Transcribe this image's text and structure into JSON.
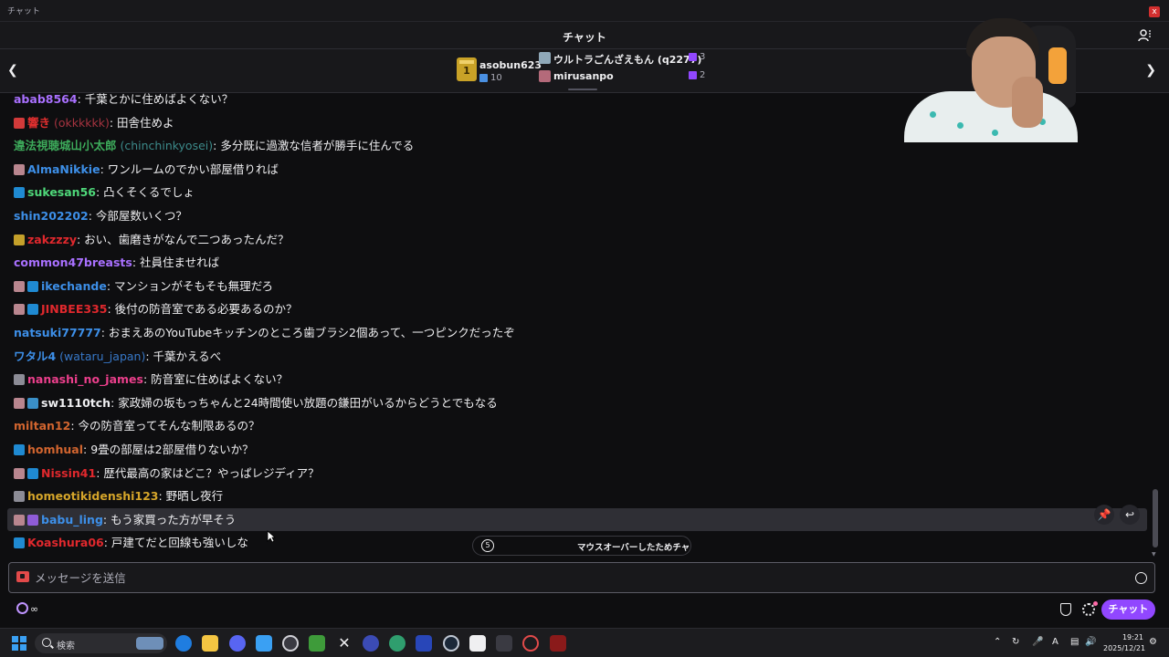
{
  "window": {
    "title": "チャット",
    "close_label": "x"
  },
  "header": {
    "title": "チャット"
  },
  "leaderboard": {
    "first": {
      "name": "asobun623",
      "rank": "1",
      "count": "10"
    },
    "others": [
      {
        "name": "ウルトラごんざえもん (q2277)",
        "count": "3"
      },
      {
        "name": "mirusanpo",
        "count": "2"
      }
    ]
  },
  "messages": [
    {
      "user": "abab8564",
      "user_color": "#a970ff",
      "alt": "",
      "text": ": 千葉とかに住めばよくない？",
      "badges": []
    },
    {
      "user": "響き",
      "user_color": "#e02f2f",
      "alt": " (okkkkkk)",
      "alt_class": "red",
      "text": ": 田舎住めよ",
      "badges": [
        "b-red"
      ]
    },
    {
      "user": "違法視聴城山小太郎",
      "user_color": "#3dab5b",
      "alt": " (chinchinkyosei)",
      "alt_class": "",
      "text": ": 多分既に過激な信者が勝手に住んでる",
      "badges": []
    },
    {
      "user": "AlmaNikkie",
      "user_color": "#3d8fe8",
      "alt": "",
      "text": ": ワンルームのでかい部屋借りれば",
      "badges": [
        "b-avatar"
      ]
    },
    {
      "user": "sukesan56",
      "user_color": "#4fd87a",
      "alt": "",
      "text": ": 凸くそくるでしょ",
      "badges": [
        "b-sub"
      ]
    },
    {
      "user": "shin202202",
      "user_color": "#3d8fe8",
      "alt": "",
      "text": ": 今部屋数いくつ？",
      "badges": []
    },
    {
      "user": "zakzzzy",
      "user_color": "#e0282d",
      "alt": "",
      "text": ": おい、歯磨きがなんで二つあったんだ？",
      "badges": [
        "b-gold"
      ]
    },
    {
      "user": "common47breasts",
      "user_color": "#a970ff",
      "alt": "",
      "text": ": 社員住ませれば",
      "badges": []
    },
    {
      "user": "ikechande",
      "user_color": "#3d8fe8",
      "alt": "",
      "text": ": マンションがそもそも無理だろ",
      "badges": [
        "b-avatar",
        "b-sub"
      ]
    },
    {
      "user": "JINBEE335",
      "user_color": "#e0282d",
      "alt": "",
      "text": ": 後付の防音室である必要あるのか？",
      "badges": [
        "b-avatar",
        "b-sub"
      ]
    },
    {
      "user": "natsuki77777",
      "user_color": "#3d8fe8",
      "alt": "",
      "text": ": おまえあのYouTubeキッチンのところ歯ブラシ2個あって、一つピンクだったぞ",
      "badges": []
    },
    {
      "user": "ワタル4",
      "user_color": "#3d8fe8",
      "alt": " (wataru_japan)",
      "alt_class": "blue",
      "text": ": 千葉かえるべ",
      "badges": []
    },
    {
      "user": "nanashi_no_james",
      "user_color": "#ec3f8c",
      "alt": "",
      "text": ": 防音室に住めばよくない？",
      "badges": [
        "b-grey"
      ]
    },
    {
      "user": "sw1110tch",
      "user_color": "#efeff1",
      "alt": "",
      "text": ": 家政婦の坂もっちゃんと24時間使い放題の鎌田がいるからどうとでもなる",
      "badges": [
        "b-avatar",
        "b-teal"
      ]
    },
    {
      "user": "miltan12",
      "user_color": "#d2652f",
      "alt": "",
      "text": ": 今の防音室ってそんな制限あるの？",
      "badges": []
    },
    {
      "user": "homhual",
      "user_color": "#d2652f",
      "alt": "",
      "text": ": 9畳の部屋は2部屋借りないか？",
      "badges": [
        "b-sub"
      ]
    },
    {
      "user": "Nissin41",
      "user_color": "#e0282d",
      "alt": "",
      "text": ": 歴代最高の家はどこ？やっぱレジディア？",
      "badges": [
        "b-avatar",
        "b-sub"
      ]
    },
    {
      "user": "homeotikidenshi123",
      "user_color": "#d5a52a",
      "alt": "",
      "text": ": 野晒し夜行",
      "badges": [
        "b-grey"
      ]
    },
    {
      "user": "babu_ling",
      "user_color": "#3d8fe8",
      "alt": "",
      "text": ": もう家買った方が早そう",
      "badges": [
        "b-avatar",
        "b-purple"
      ],
      "highlight": true
    },
    {
      "user": "Koashura06",
      "user_color": "#e0282d",
      "alt": "",
      "text": ": 戸建てだと回線も強いしな",
      "badges": [
        "b-sub"
      ]
    }
  ],
  "paused": {
    "label": "マウスオーバーしたためチャ"
  },
  "input": {
    "placeholder": "メッセージを送信"
  },
  "bottom": {
    "points": "∞",
    "chat_button": "チャット"
  },
  "taskbar": {
    "search_label": "検索",
    "clock_time": "19:21",
    "clock_date": "2025/12/21",
    "ime": "A"
  },
  "colors": {
    "accent": "#9147ff",
    "background": "#0e0e10"
  }
}
